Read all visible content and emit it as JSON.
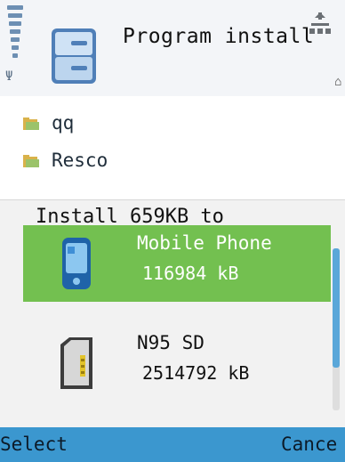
{
  "header": {
    "title": "Program install",
    "app_icon": "install-app-icon",
    "signal_icon": "signal-strength-icon",
    "network_icon": "network-icon"
  },
  "list": {
    "items": [
      {
        "label": "qq",
        "icon": "folder-icon"
      },
      {
        "label": "Resco",
        "icon": "folder-icon"
      }
    ]
  },
  "dialog": {
    "title": "Install 659KB to",
    "options": [
      {
        "name": "Mobile Phone",
        "size": "116984 kB",
        "icon": "phone-memory-icon",
        "selected": true
      },
      {
        "name": "N95 SD",
        "size": "2514792 kB",
        "icon": "memory-card-icon",
        "selected": false
      }
    ],
    "scroll_position": 0.0
  },
  "softkeys": {
    "left": "Select",
    "right": "Cance"
  },
  "colors": {
    "selected": "#73c050",
    "softkey_bar": "#3b97cf",
    "scroll_thumb": "#5aa7d9"
  }
}
